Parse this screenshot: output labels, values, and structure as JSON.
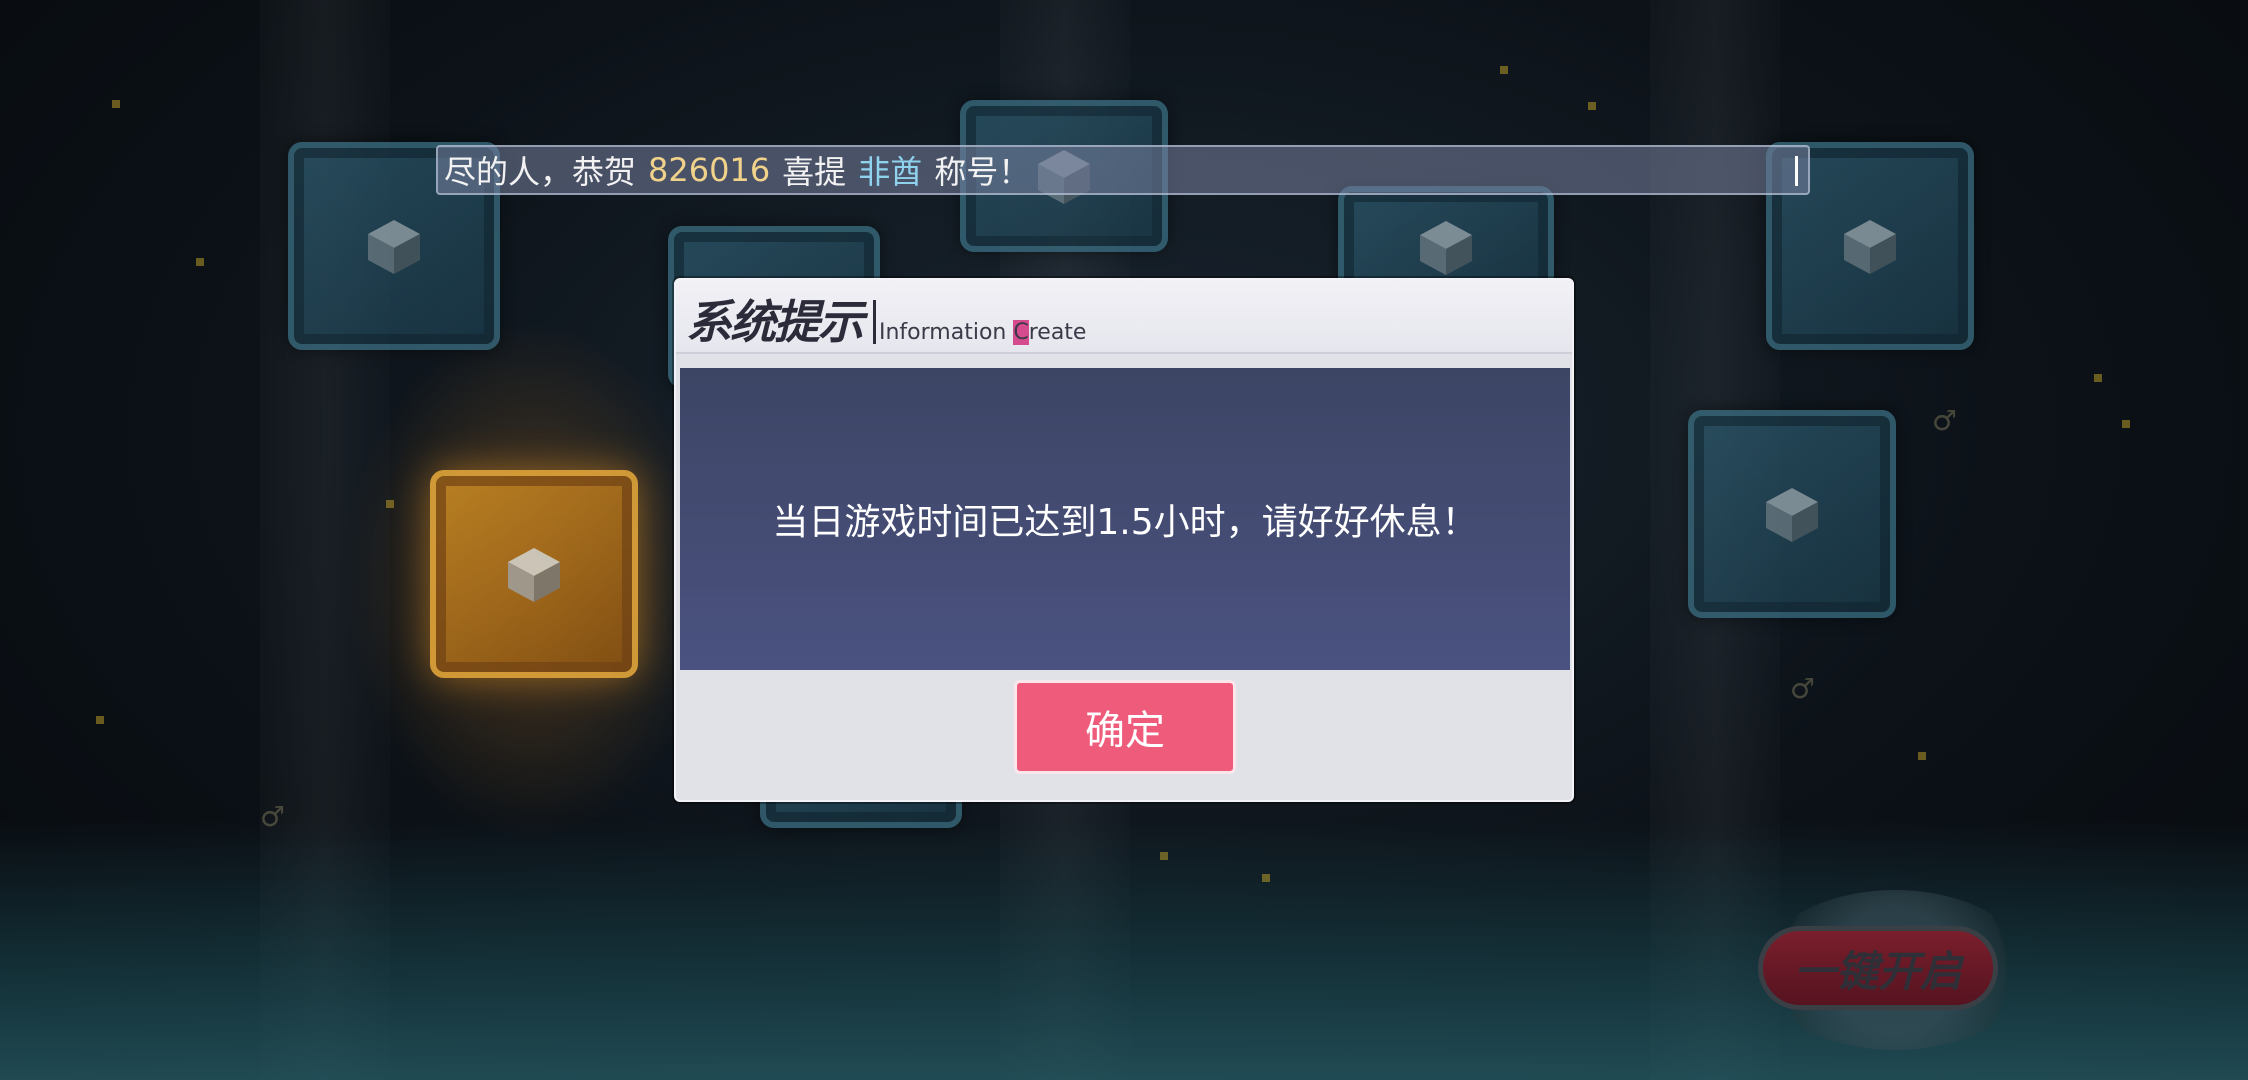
{
  "marquee": {
    "prefix": "尽的人，恭贺",
    "player_id": "826016",
    "middle": "喜提",
    "title_name": "非酋",
    "suffix": "称号！"
  },
  "dialog": {
    "title": "系统提示",
    "subtitle_before": "Information ",
    "subtitle_highlight": "C",
    "subtitle_after": "reate",
    "message": "当日游戏时间已达到1.5小时，请好好休息！",
    "confirm_label": "确定"
  },
  "open_all_label": "一键开启",
  "colors": {
    "player_id": "#f0d28a",
    "title_name": "#8fd2ee",
    "confirm_button": "#ef5b7a",
    "dialog_body": "#454d72"
  }
}
